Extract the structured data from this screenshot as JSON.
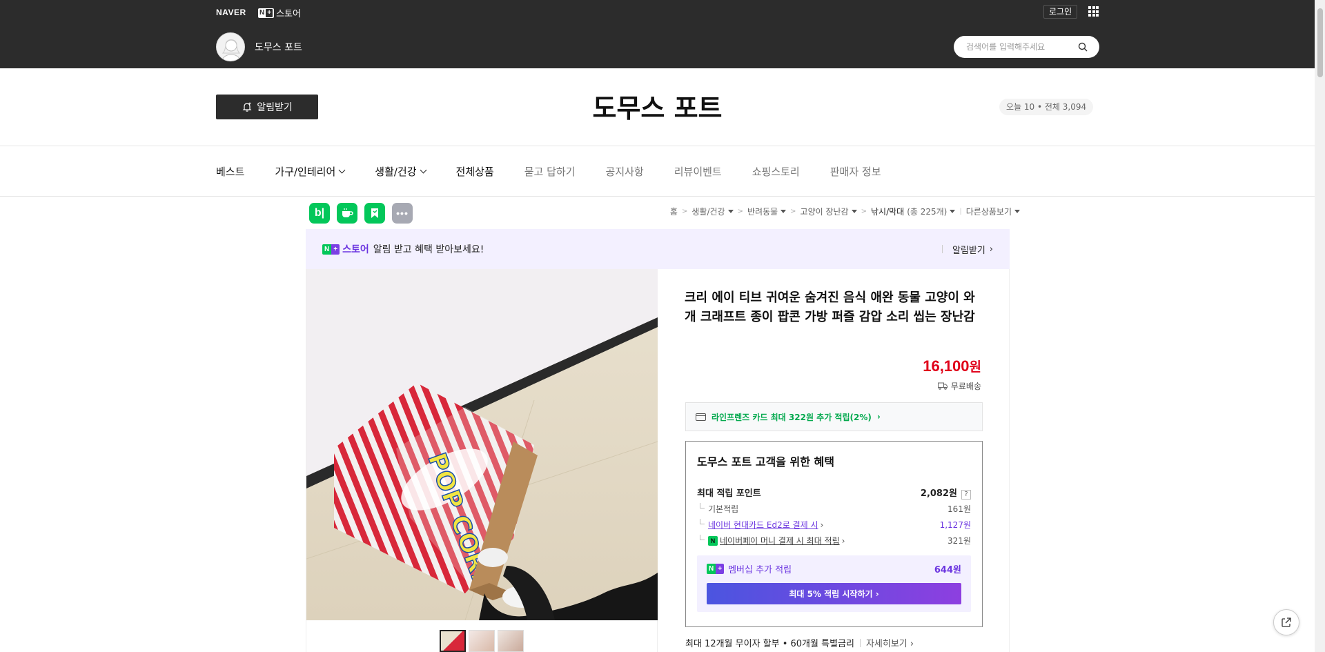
{
  "header": {
    "naver_logo": "NAVER",
    "nstore_label": "스토어",
    "login": "로그인",
    "store_name": "도무스 포트",
    "search_placeholder": "검색어를 입력해주세요"
  },
  "store_bar": {
    "alarm_button": "알림받기",
    "title": "도무스 포트",
    "visit_count": "오늘 10 • 전체 3,094"
  },
  "nav": [
    {
      "label": "베스트",
      "dropdown": false,
      "style": "dark"
    },
    {
      "label": "가구/인테리어",
      "dropdown": true,
      "style": "dark"
    },
    {
      "label": "생활/건강",
      "dropdown": true,
      "style": "dark"
    },
    {
      "label": "전체상품",
      "dropdown": false,
      "style": "dark"
    },
    {
      "label": "묻고 답하기",
      "dropdown": false,
      "style": "light"
    },
    {
      "label": "공지사항",
      "dropdown": false,
      "style": "light"
    },
    {
      "label": "리뷰이벤트",
      "dropdown": false,
      "style": "light"
    },
    {
      "label": "쇼핑스토리",
      "dropdown": false,
      "style": "light"
    },
    {
      "label": "판매자 정보",
      "dropdown": false,
      "style": "light"
    }
  ],
  "share_icons": [
    "blog-icon",
    "cafe-icon",
    "keep-icon",
    "more-icon"
  ],
  "breadcrumb": {
    "home": "홈",
    "c1": "생활/건강",
    "c2": "반려동물",
    "c3": "고양이 장난감",
    "c4": "낚시/막대",
    "c4_count": "(총 225개)",
    "other": "다른상품보기"
  },
  "promo": {
    "store": "스토어",
    "text": "알림 받고 혜택 받아보세요!",
    "button": "알림받기"
  },
  "product": {
    "title": "크리 에이 티브 귀여운 숨겨진 음식 애완 동물 고양이 와 개 크래프트 종이 팝콘 가방 퍼즐 감압 소리 씹는 장난감",
    "price": "16,100",
    "price_unit": "원",
    "shipping": "무료배송",
    "card_benefit": "라인프렌즈 카드 최대 322원 추가 적립(2%)",
    "bag_text": "POP CORN"
  },
  "benefit": {
    "title": "도무스 포트 고객을 위한 혜택",
    "max_point_label": "최대 적립 포인트",
    "max_point_value": "2,082원",
    "base_label": "기본적립",
    "base_value": "161원",
    "card_label": "네이버 현대카드 Ed2로 결제 시",
    "card_value": "1,127원",
    "pay_label": "네이버페이 머니 결제 시 최대 적립",
    "pay_value": "321원",
    "member_label": "멤버십 추가 적립",
    "member_value": "644원",
    "member_button": "최대 5% 적립 시작하기"
  },
  "installment": {
    "text": "최대 12개월 무이자 할부 • 60개월 특별금리",
    "more": "자세히보기"
  },
  "colors": {
    "header_bg": "#2c2c2c",
    "naver_green": "#03c75a",
    "plus_purple": "#6b35e0",
    "price_red": "#e0001a"
  }
}
